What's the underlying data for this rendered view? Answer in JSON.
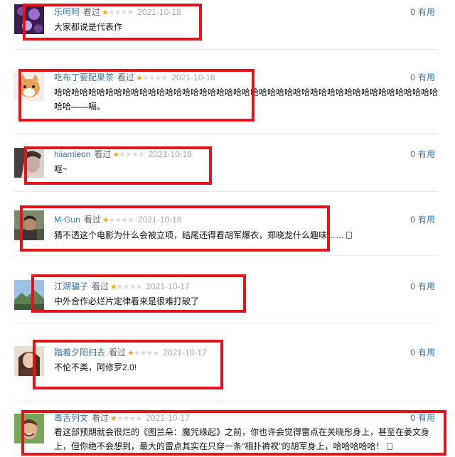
{
  "comments": [
    {
      "user": "乐呵呵",
      "status": "看过",
      "rating_stars": 1,
      "time": "2021-10-18",
      "votes": "0",
      "useful_label": "有用",
      "text": "大家都说是代表作",
      "avatar_icon": "user-avatar-icon"
    },
    {
      "user": "吃布丁要配果茶",
      "status": "看过",
      "rating_stars": 1,
      "time": "2021-10-18",
      "votes": "0",
      "useful_label": "有用",
      "text": "哈哈哈哈哈哈哈哈哈哈哈哈哈哈哈哈哈哈哈哈哈哈哈哈哈哈哈哈哈哈哈哈哈哈哈哈哈哈哈哈哈哈哈哈哈哈哈——嗝。",
      "avatar_icon": "user-avatar-icon"
    },
    {
      "user": "hiiamleon",
      "status": "看过",
      "rating_stars": 1,
      "time": "2021-10-18",
      "votes": "0",
      "useful_label": "有用",
      "text": "呕~",
      "avatar_icon": "user-avatar-icon"
    },
    {
      "user": "M-Gun",
      "status": "看过",
      "rating_stars": 1,
      "time": "2021-10-18",
      "votes": "0",
      "useful_label": "有用",
      "text": "猜不透这个电影为什么会被立项，结尾还得看胡军爆衣，郑晓龙什么趣味……",
      "avatar_icon": "user-avatar-icon"
    },
    {
      "user": "江湖骗子",
      "status": "看过",
      "rating_stars": 1,
      "time": "2021-10-17",
      "votes": "0",
      "useful_label": "有用",
      "text": "中外合作必烂片定律看来是很难打破了",
      "avatar_icon": "user-avatar-icon"
    },
    {
      "user": "踏着夕阳归去",
      "status": "看过",
      "rating_stars": 1,
      "time": "2021-10-17",
      "votes": "0",
      "useful_label": "有用",
      "text": "不伦不类，阿修罗2.0!",
      "avatar_icon": "user-avatar-icon"
    },
    {
      "user": "毒舌列文",
      "status": "看过",
      "rating_stars": 1,
      "time": "2021-10-17",
      "votes": "0",
      "useful_label": "有用",
      "text": "看这部预期就会很烂的《图兰朵：魔咒缘起》之前，你也许会觉得雷点在关晓彤身上，甚至在姜文身上，但你绝不会想到，最大的雷点其实在只穿一条\"相扑裤衩\"的胡军身上，哈哈哈哈哈！",
      "avatar_icon": "user-avatar-icon"
    }
  ],
  "colors": {
    "link": "#3377aa",
    "star": "#f5a623",
    "highlight": "#e5141b"
  }
}
